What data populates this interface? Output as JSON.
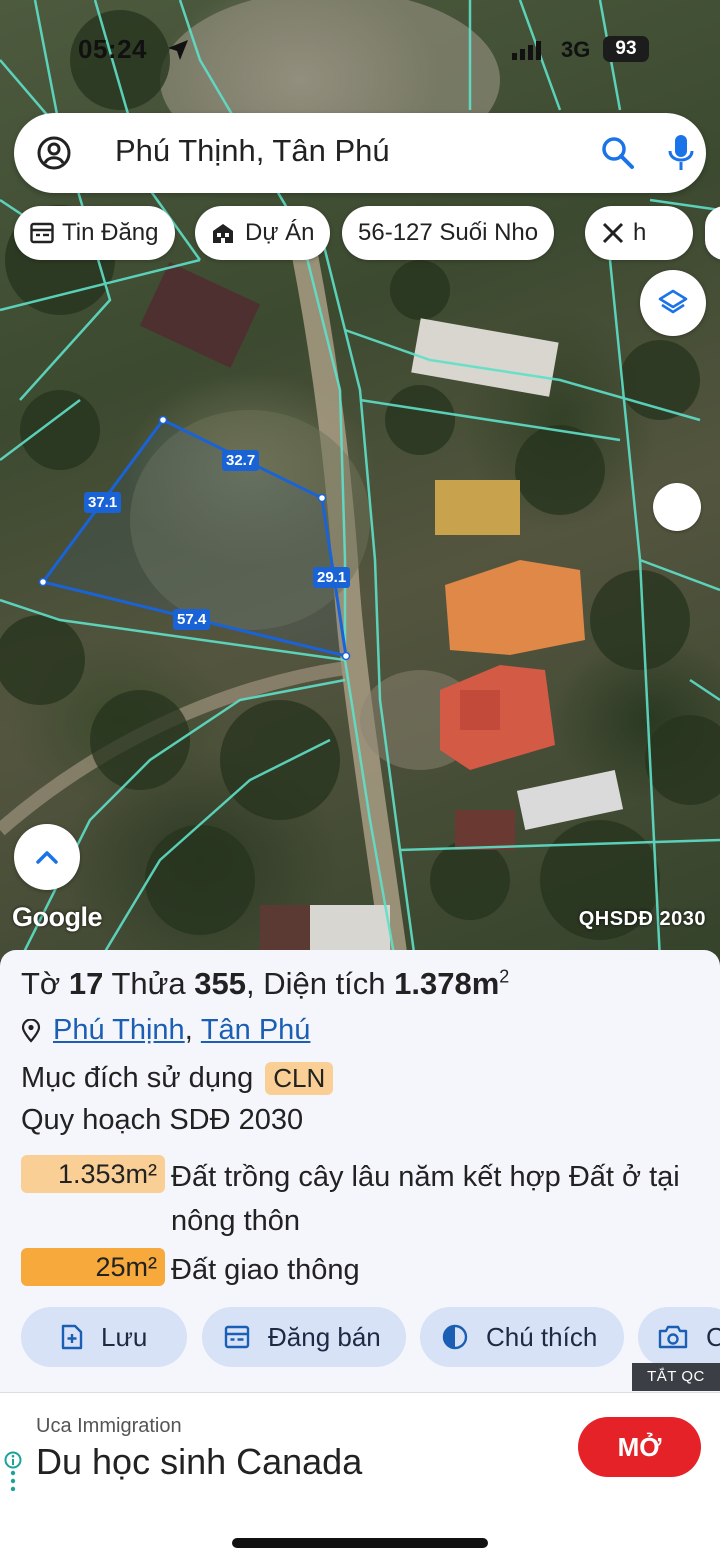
{
  "status_bar": {
    "time": "05:24",
    "network": "3G",
    "battery": "93"
  },
  "search": {
    "query": "Phú Thịnh, Tân Phú"
  },
  "chips": [
    {
      "label": "Tin Đăng",
      "icon": "listing-icon"
    },
    {
      "label": "Dự Án",
      "icon": "building-icon"
    },
    {
      "label": "56-127 Suối Nho",
      "icon": ""
    },
    {
      "label": "h",
      "icon": "ruler-icon"
    }
  ],
  "map": {
    "edge_labels": [
      "32.7",
      "37.1",
      "29.1",
      "57.4"
    ],
    "google_label": "Google",
    "layer_label": "QHSDĐ 2030",
    "parcel_color": "#1a63d6",
    "boundary_color": "#5fe0c8"
  },
  "parcel": {
    "title_prefix": "Tờ",
    "sheet": "17",
    "plot_label": "Thửa",
    "plot": "355",
    "area_label": ", Diện tích",
    "area": "1.378m",
    "area_sup": "2",
    "location_1": "Phú Thịnh",
    "location_sep": ",",
    "location_2": "Tân Phú",
    "purpose_label": "Mục đích sử dụng",
    "purpose_code": "CLN",
    "plan_label": "Quy hoạch SDĐ 2030",
    "zones": [
      {
        "area": "1.353m²",
        "description": "Đất trồng cây lâu năm kết hợp Đất ở tại nông thôn",
        "color": "#f9cf95"
      },
      {
        "area": "25m²",
        "description": "Đất giao thông",
        "color": "#f7a93c"
      }
    ]
  },
  "actions": [
    {
      "label": "Lưu",
      "icon": "save-plus-icon"
    },
    {
      "label": "Đăng bán",
      "icon": "listing-icon"
    },
    {
      "label": "Chú thích",
      "icon": "contrast-icon"
    },
    {
      "label": "C",
      "icon": "camera-icon"
    }
  ],
  "ad": {
    "close_label": "TẮT QC",
    "advertiser": "Uca Immigration",
    "headline": "Du học sinh Canada",
    "cta": "MỞ"
  }
}
